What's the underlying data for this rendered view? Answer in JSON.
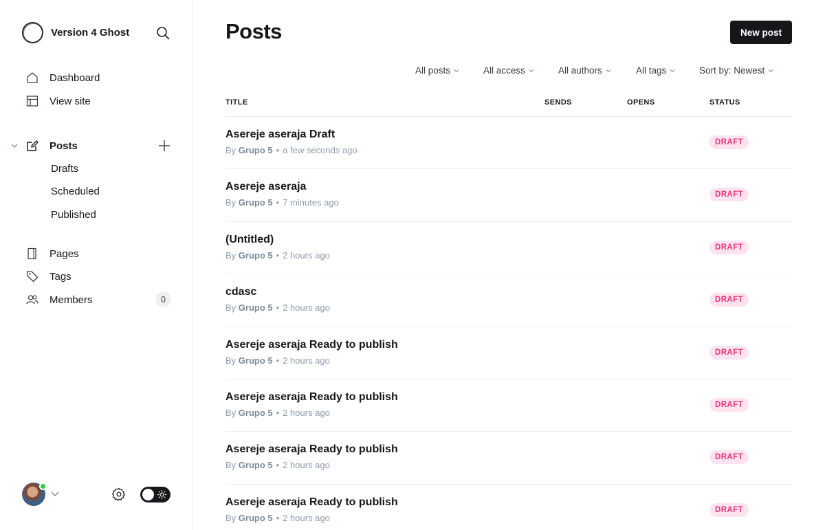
{
  "site": {
    "name": "Version 4 Ghost"
  },
  "nav": {
    "dashboard": "Dashboard",
    "view_site": "View site",
    "posts": "Posts",
    "drafts": "Drafts",
    "scheduled": "Scheduled",
    "published": "Published",
    "pages": "Pages",
    "tags": "Tags",
    "members": "Members",
    "members_count": "0"
  },
  "header": {
    "title": "Posts",
    "new_post": "New post"
  },
  "filters": {
    "posts": "All posts",
    "access": "All access",
    "authors": "All authors",
    "tags": "All tags",
    "sort": "Sort by: Newest"
  },
  "table": {
    "headers": {
      "title": "TITLE",
      "sends": "SENDS",
      "opens": "OPENS",
      "status": "STATUS"
    },
    "rows": [
      {
        "title": "Asereje aseraja Draft",
        "by": "By",
        "author": "Grupo 5",
        "time": "a few seconds ago",
        "status": "DRAFT"
      },
      {
        "title": "Asereje aseraja",
        "by": "By",
        "author": "Grupo 5",
        "time": "7 minutes ago",
        "status": "DRAFT"
      },
      {
        "title": "(Untitled)",
        "by": "By",
        "author": "Grupo 5",
        "time": "2 hours ago",
        "status": "DRAFT"
      },
      {
        "title": "cdasc",
        "by": "By",
        "author": "Grupo 5",
        "time": "2 hours ago",
        "status": "DRAFT"
      },
      {
        "title": "Asereje aseraja Ready to publish",
        "by": "By",
        "author": "Grupo 5",
        "time": "2 hours ago",
        "status": "DRAFT"
      },
      {
        "title": "Asereje aseraja Ready to publish",
        "by": "By",
        "author": "Grupo 5",
        "time": "2 hours ago",
        "status": "DRAFT"
      },
      {
        "title": "Asereje aseraja Ready to publish",
        "by": "By",
        "author": "Grupo 5",
        "time": "2 hours ago",
        "status": "DRAFT"
      },
      {
        "title": "Asereje aseraja Ready to publish",
        "by": "By",
        "author": "Grupo 5",
        "time": "2 hours ago",
        "status": "DRAFT"
      }
    ]
  },
  "icons": {
    "logo": "ghost-ring-logo",
    "search": "search-icon",
    "dashboard": "home-icon",
    "view_site": "layout-icon",
    "posts": "pencil-edit-icon",
    "add": "plus-icon",
    "pages": "page-icon",
    "tags": "tag-icon",
    "members": "users-icon",
    "settings": "gear-icon",
    "theme": "sun-icon"
  },
  "colors": {
    "accent": "#15171a",
    "draft_bg": "#fde3ef",
    "draft_text": "#e8357d",
    "online": "#30cf43"
  }
}
